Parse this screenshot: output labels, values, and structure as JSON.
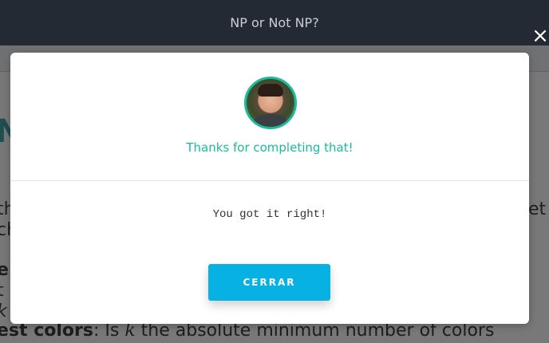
{
  "background_page": {
    "title": "NP or Not NP?",
    "letter": "N",
    "frag_left_1": "th",
    "frag_left_2": "ch",
    "frag_left_3": "e",
    "frag_left_4": "t",
    "frag_left_5": "k",
    "frag_right_1": "et",
    "frag_right_2": "",
    "bottom_line_bold": "est colors",
    "bottom_line_colon": ":",
    "bottom_line_is": " Is ",
    "bottom_line_k": "k",
    "bottom_line_rest": " the absolute minimum number of colors"
  },
  "overlay": {
    "close_icon": "×"
  },
  "modal": {
    "heading": "Thanks for completing that!",
    "message": "You got it right!",
    "button_label": "CERRAR",
    "accent_color": "#1abc9c",
    "button_color": "#08b1e4"
  }
}
